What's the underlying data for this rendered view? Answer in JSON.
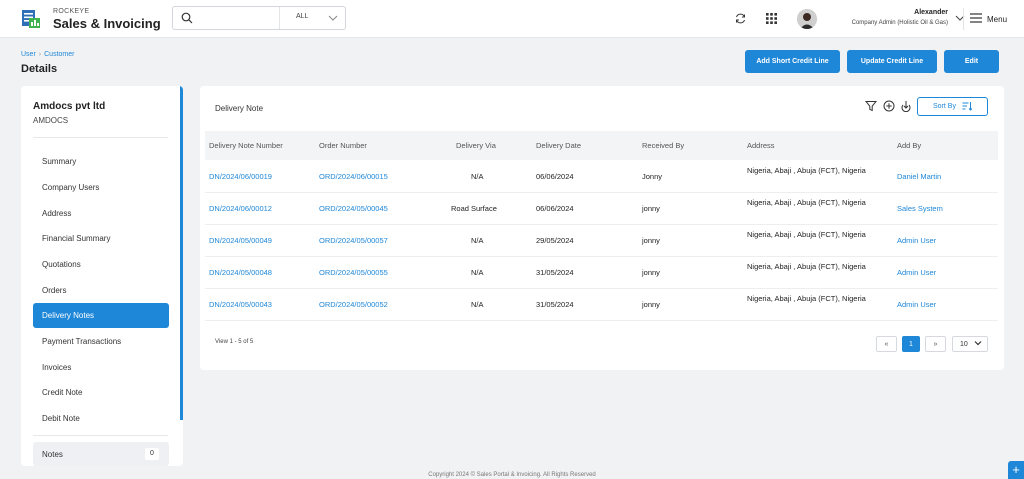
{
  "header": {
    "brand_small": "ROCKEYE",
    "brand_name": "Sales & Invoicing",
    "search_placeholder": "",
    "search_scope": "ALL",
    "user_name": "Alexander",
    "user_role": "Company Admin (Holistic Oil & Gas)",
    "menu_label": "Menu"
  },
  "breadcrumb": {
    "items": [
      "User",
      "Customer"
    ]
  },
  "page_title": "Details",
  "actions": {
    "add_short_credit": "Add Short Credit Line",
    "update_credit": "Update Credit Line",
    "edit": "Edit"
  },
  "sidebar": {
    "company_name": "Amdocs pvt ltd",
    "company_code": "AMDOCS",
    "items": [
      {
        "label": "Summary"
      },
      {
        "label": "Company Users"
      },
      {
        "label": "Address"
      },
      {
        "label": "Financial Summary"
      },
      {
        "label": "Quotations"
      },
      {
        "label": "Orders"
      },
      {
        "label": "Delivery Notes"
      },
      {
        "label": "Payment Transactions"
      },
      {
        "label": "Invoices"
      },
      {
        "label": "Credit Note"
      },
      {
        "label": "Debit Note"
      }
    ],
    "active_index": 6,
    "notes_label": "Notes",
    "notes_count": "0"
  },
  "card": {
    "title": "Delivery Note",
    "sort_label": "Sort By",
    "columns": [
      "Delivery Note Number",
      "Order Number",
      "Delivery Via",
      "Delivery Date",
      "Received By",
      "Address",
      "Add By"
    ],
    "rows": [
      {
        "dn": "DN/2024/06/00019",
        "order": "ORD/2024/06/00015",
        "via": "N/A",
        "date": "06/06/2024",
        "received": "Jonny",
        "address": "Nigeria,  Abaji , Abuja (FCT), Nigeria",
        "added_by": "Daniel Martin"
      },
      {
        "dn": "DN/2024/06/00012",
        "order": "ORD/2024/05/00045",
        "via": "Road Surface",
        "date": "06/06/2024",
        "received": "jonny",
        "address": "Nigeria,  Abaji , Abuja (FCT), Nigeria",
        "added_by": "Sales System"
      },
      {
        "dn": "DN/2024/05/00049",
        "order": "ORD/2024/05/00057",
        "via": "N/A",
        "date": "29/05/2024",
        "received": "jonny",
        "address": "Nigeria,  Abaji , Abuja (FCT), Nigeria",
        "added_by": "Admin User"
      },
      {
        "dn": "DN/2024/05/00048",
        "order": "ORD/2024/05/00055",
        "via": "N/A",
        "date": "31/05/2024",
        "received": "jonny",
        "address": "Nigeria,  Abaji , Abuja (FCT), Nigeria",
        "added_by": "Admin User"
      },
      {
        "dn": "DN/2024/05/00043",
        "order": "ORD/2024/05/00052",
        "via": "N/A",
        "date": "31/05/2024",
        "received": "jonny",
        "address": "Nigeria,  Abaji , Abuja (FCT), Nigeria",
        "added_by": "Admin User"
      }
    ],
    "view_count": "View 1 - 5 of 5",
    "pagination": {
      "prev": "«",
      "current": "1",
      "next": "»",
      "page_size": "10"
    }
  },
  "footer": "Copyright 2024 © Sales Portal & Invoicing. All Rights Reserved",
  "fab_label": "+",
  "colors": {
    "accent": "#1e87d8",
    "background": "#f1f2f4"
  }
}
